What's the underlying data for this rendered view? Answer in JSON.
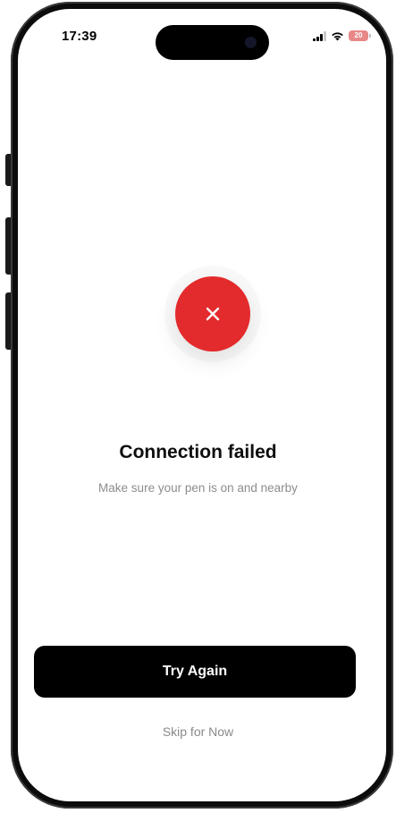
{
  "status_bar": {
    "time": "17:39",
    "battery_label": "20",
    "icons": [
      "signal-icon",
      "wifi-icon",
      "battery-icon"
    ],
    "battery_color": "#e88787"
  },
  "error": {
    "icon": "close-icon",
    "color": "#e32a2c",
    "title": "Connection failed",
    "message": "Make sure your pen is on and nearby"
  },
  "actions": {
    "primary_label": "Try Again",
    "secondary_label": "Skip for Now"
  }
}
